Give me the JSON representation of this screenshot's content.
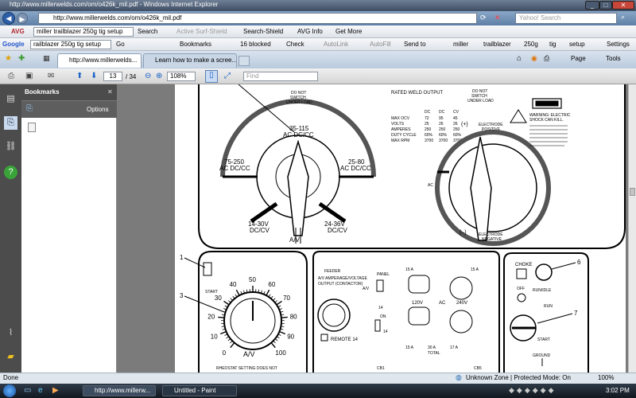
{
  "window": {
    "title": "http://www.millerwelds.com/om/o426k_mil.pdf - Windows Internet Explorer"
  },
  "address_bar": {
    "url": "http://www.millerwelds.com/om/o426k_mil.pdf",
    "search_placeholder": "Yahoo! Search"
  },
  "avg_toolbar": {
    "logo": "AVG",
    "search_value": "miller trailblazer 250g tig setup",
    "search_button": "Search",
    "active_surf": "Active Surf-Shield",
    "search_shield": "Search-Shield",
    "avg_info": "AVG Info",
    "get_more": "Get More"
  },
  "google_toolbar": {
    "logo": "Google",
    "query": "railblazer 250g tig setup",
    "go": "Go",
    "bookmarks": "Bookmarks",
    "blocked": "16 blocked",
    "check": "Check",
    "autolink": "AutoLink",
    "autofill": "AutoFill",
    "send_to": "Send to",
    "terms": [
      "miller",
      "trailblazer",
      "250g",
      "tig",
      "setup"
    ],
    "settings": "Settings"
  },
  "tabs": [
    {
      "label": "http://www.millerwelds..."
    },
    {
      "label": "Learn how to make a scree..."
    }
  ],
  "command_bar": {
    "page": "Page",
    "tools": "Tools"
  },
  "pdf_toolbar": {
    "page_current": "13",
    "page_total": "/ 34",
    "zoom": "108%",
    "find_placeholder": "Find"
  },
  "bookmarks_panel": {
    "title": "Bookmarks",
    "options": "Options"
  },
  "diagram": {
    "top": {
      "rated_weld_output": "RATED WELD OUTPUT",
      "do_not_switch_1": "DO NOT",
      "do_not_switch_2": "SWITCH",
      "do_not_switch_3": "UNDER LOAD",
      "range_35_115": "35-115",
      "range_35_115_sub": "AC DC/CC",
      "range_75_250": "75-250",
      "range_75_250_sub": "AC DC/CC",
      "range_25_80": "25-80",
      "range_25_80_sub": "AC DC/CC",
      "range_14_30": "14-30V",
      "range_14_30_sub": "DC/CV",
      "range_24_36": "24-36V",
      "range_24_36_sub": "DC/CV",
      "av_label": "A/V",
      "table_cols": [
        "DC",
        "DC",
        "CV"
      ],
      "table_rows": [
        [
          "MAX OCV",
          "72",
          "95",
          "45"
        ],
        [
          "VOLTS",
          "25",
          "26",
          "26"
        ],
        [
          "AMPERES",
          "250",
          "250",
          "250"
        ],
        [
          "DUTY CYCLE",
          "60%",
          "60%",
          "60%"
        ],
        [
          "MAX RPM",
          "3700",
          "3700",
          "3700"
        ]
      ],
      "warning_1": "WARNING: ELECTRIC",
      "warning_2": "SHOCK CAN KILL.",
      "electrode": "ELECTRODE",
      "positive": "POSITIVE",
      "electrode_neg": "ELECTRODE",
      "negative": "NEGATIVE",
      "plus": "(+)",
      "minus": "(–)",
      "ac_label": "AC"
    },
    "left": {
      "callout_1": "1",
      "callout_3": "3",
      "dial_marks": [
        "0",
        "10",
        "20",
        "30",
        "40",
        "50",
        "60",
        "70",
        "80",
        "90",
        "100"
      ],
      "av_label": "A/V",
      "rheostat": "RHEOSTAT SETTING DOES NOT",
      "switch_label": "START"
    },
    "middle": {
      "feeder": "FEEDER",
      "amperage_voltage": "A/V AMPERAGE/VOLTAGE",
      "output_contactor": "OUTPUT (CONTACTOR)",
      "panel": "PANEL",
      "av": "A/V",
      "remote": "REMOTE 14",
      "on": "ON",
      "r14": "14",
      "amps_15": "15 A",
      "v120": "120V",
      "ac": "AC",
      "v240": "240V",
      "amps_30": "30 A",
      "amps_17": "17 A",
      "total": "TOTAL",
      "cb1": "CB1",
      "cb5": "CB5"
    },
    "right": {
      "choke": "CHOKE",
      "callout_6": "6",
      "callout_7": "7",
      "off": "OFF",
      "run_idle": "RUN/IDLE",
      "run": "RUN",
      "start": "START",
      "ground": "GROUND"
    }
  },
  "status_bar": {
    "left": "Done",
    "zone": "Unknown Zone | Protected Mode: On",
    "zoom": "100%"
  },
  "taskbar": {
    "items": [
      {
        "label": "http://www.millerw..."
      },
      {
        "label": "Untitled - Paint"
      }
    ],
    "clock": "3:02 PM"
  }
}
